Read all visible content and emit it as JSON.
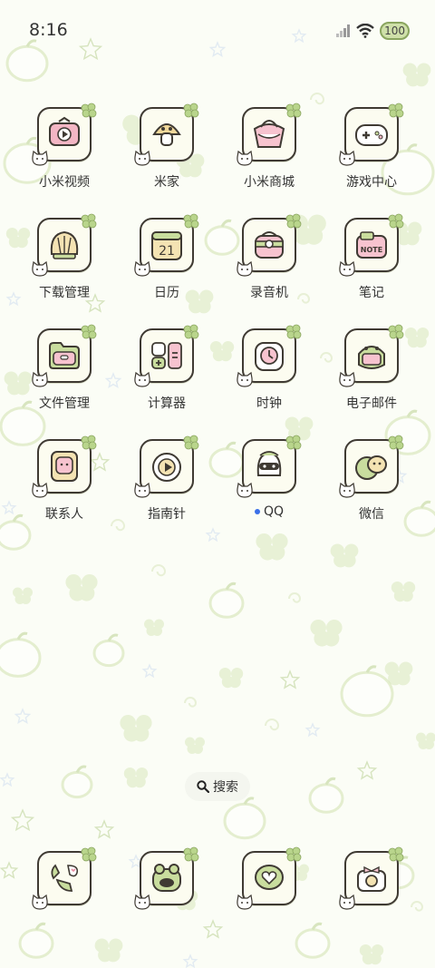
{
  "status": {
    "time": "8:16",
    "battery": "100"
  },
  "apps": [
    {
      "label": "小米视频",
      "icon": "tv-icon"
    },
    {
      "label": "米家",
      "icon": "mushroom-icon"
    },
    {
      "label": "小米商城",
      "icon": "bag-icon"
    },
    {
      "label": "游戏中心",
      "icon": "gamepad-icon"
    },
    {
      "label": "下载管理",
      "icon": "shell-icon"
    },
    {
      "label": "日历",
      "icon": "calendar-icon",
      "day": "21"
    },
    {
      "label": "录音机",
      "icon": "recorder-icon"
    },
    {
      "label": "笔记",
      "icon": "note-icon",
      "note_text": "NOTE"
    },
    {
      "label": "文件管理",
      "icon": "folder-icon"
    },
    {
      "label": "计算器",
      "icon": "calculator-icon"
    },
    {
      "label": "时钟",
      "icon": "clock-icon"
    },
    {
      "label": "电子邮件",
      "icon": "mail-frog-icon"
    },
    {
      "label": "联系人",
      "icon": "contacts-icon"
    },
    {
      "label": "指南针",
      "icon": "compass-icon"
    },
    {
      "label": "QQ",
      "icon": "qq-penguin-icon",
      "new": true
    },
    {
      "label": "微信",
      "icon": "wechat-icon"
    }
  ],
  "search": {
    "label": "搜索"
  },
  "dock": [
    {
      "icon": "phone-leaf-icon"
    },
    {
      "icon": "frog-browser-icon"
    },
    {
      "icon": "heart-message-icon"
    },
    {
      "icon": "camera-bow-icon"
    }
  ],
  "theme": {
    "accent": "#cfe0a9",
    "outline": "#3f3a33",
    "background": "#fbfdf6",
    "dot": "#3a6fe8"
  }
}
